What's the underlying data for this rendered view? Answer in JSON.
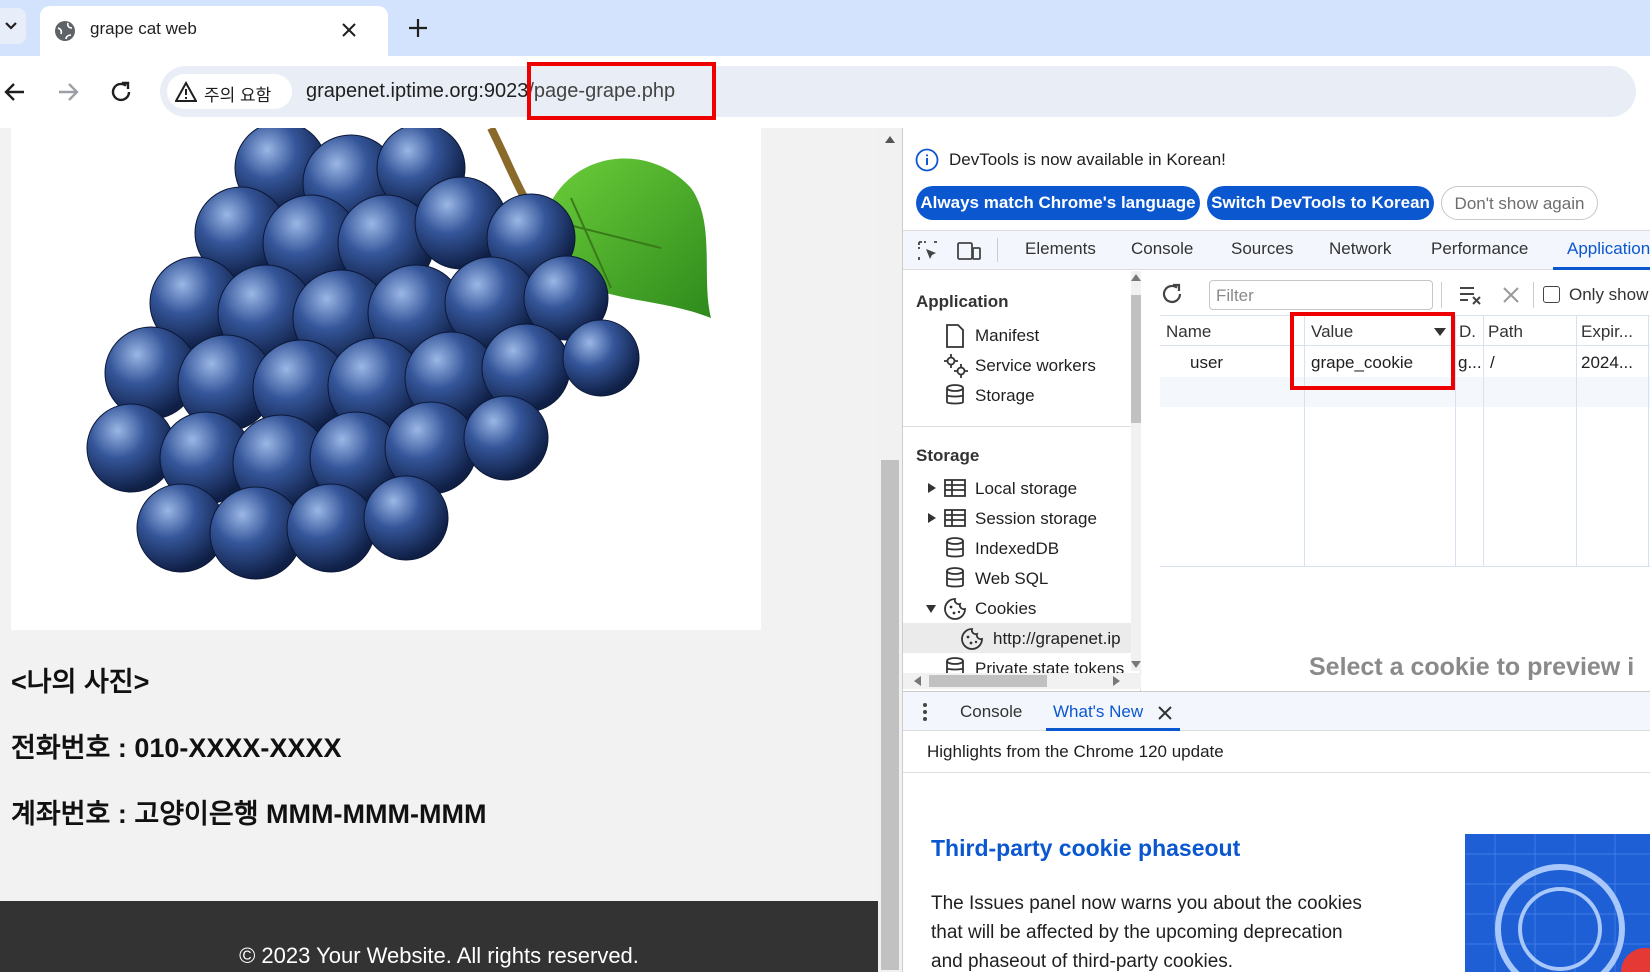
{
  "browser": {
    "tab_title": "grape cat web",
    "security_chip": "주의 요함",
    "url_host": "grapenet.iptime.org:9023",
    "url_path": "/page-grape.php"
  },
  "webpage": {
    "photo_heading": "<나의 사진>",
    "phone": "전화번호 : 010-XXXX-XXXX",
    "account": "계좌번호 : 고양이은행 MMM-MMM-MMM",
    "footer": "© 2023 Your Website. All rights reserved."
  },
  "devtools": {
    "infobar_text": "DevTools is now available in Korean!",
    "btn_match": "Always match Chrome's language",
    "btn_switch": "Switch DevTools to Korean",
    "btn_dont_show": "Don't show again",
    "tabs": [
      "Elements",
      "Console",
      "Sources",
      "Network",
      "Performance",
      "Application"
    ],
    "sidebar": {
      "app_header": "Application",
      "manifest": "Manifest",
      "service_workers": "Service workers",
      "storage_item": "Storage",
      "storage_header": "Storage",
      "local_storage": "Local storage",
      "session_storage": "Session storage",
      "indexeddb": "IndexedDB",
      "websql": "Web SQL",
      "cookies": "Cookies",
      "cookie_origin": "http://grapenet.ip",
      "private_state": "Private state tokens"
    },
    "filter_placeholder": "Filter",
    "only_show": "Only show",
    "columns": {
      "name": "Name",
      "value": "Value",
      "domain": "D.",
      "path": "Path",
      "expires": "Expir..."
    },
    "cookie_row": {
      "name": "user",
      "value": "grape_cookie",
      "domain": "g...",
      "path": "/",
      "expires": "2024..."
    },
    "preview_hint": "Select a cookie to preview i",
    "drawer_tab_console": "Console",
    "drawer_tab_whatsnew": "What's New",
    "whatsnew_subtitle": "Highlights from the Chrome 120 update",
    "article_title": "Third-party cookie phaseout",
    "article_line1": "The Issues panel now warns you about the cookies",
    "article_line2": "that will be affected by the upcoming deprecation",
    "article_line3": "and phaseout of third-party cookies."
  },
  "colors": {
    "accent": "#0b57d0",
    "highlight": "#e00000",
    "tabbar": "#d3e3fd"
  }
}
